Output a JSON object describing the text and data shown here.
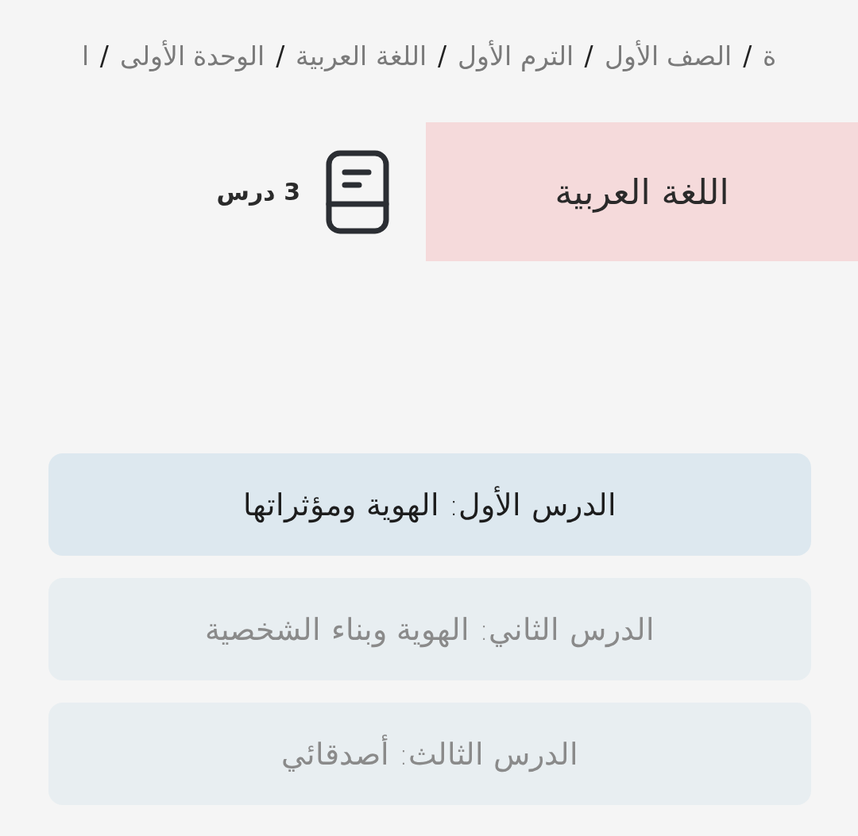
{
  "breadcrumb": {
    "separator": "/",
    "items": [
      {
        "label": "ة"
      },
      {
        "label": "الصف الأول"
      },
      {
        "label": "الترم الأول"
      },
      {
        "label": "اللغة العربية"
      },
      {
        "label": "الوحدة الأولى"
      },
      {
        "label": "ا"
      }
    ]
  },
  "subject": {
    "title": "اللغة العربية",
    "lesson_count": "3 درس"
  },
  "lessons": [
    {
      "title": "الدرس الأول: الهوية ومؤثراتها",
      "selected": true
    },
    {
      "title": "الدرس الثاني: الهوية وبناء الشخصية",
      "selected": false
    },
    {
      "title": "الدرس الثالث: أصدقائي",
      "selected": false
    }
  ]
}
